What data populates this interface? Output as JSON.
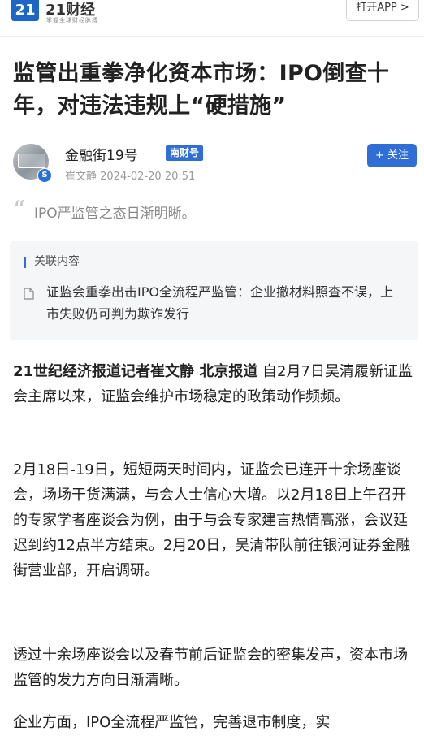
{
  "header": {
    "logo_number": "21",
    "logo_name": "21财经",
    "logo_slogan": "掌握全球财经脉搏",
    "open_app_label": "打开APP >"
  },
  "article": {
    "title": "监管出重拳净化资本市场：IPO倒查十年，对违法违规上“硬措施”",
    "author": {
      "name": "金融街19号",
      "tag": "南财号",
      "meta": "崔文静 2024-02-20 20:51",
      "badge": "S"
    },
    "follow_label": "+ 关注",
    "summary": "IPO严监管之态日渐明晰。",
    "related": {
      "heading": "关联内容",
      "link": "证监会重拳出击IPO全流程严监管：企业撤材料照查不误，上市失败仍可判为欺诈发行"
    },
    "paragraphs": {
      "p1_bold": "21世纪经济报道记者崔文静 北京报道",
      "p1_rest": " 自2月7日吴清履新证监会主席以来，证监会维护市场稳定的政策动作频频。",
      "p2": "2月18日-19日，短短两天时间内，证监会已连开十余场座谈会，场场干货满满，与会人士信心大增。以2月18日上午召开的专家学者座谈会为例，由于与会专家建言热情高涨，会议延迟到约12点半方结束。2月20日，吴清带队前往银河证券金融街营业部，开启调研。",
      "p3": "透过十余场座谈会以及春节前后证监会的密集发声，资本市场监管的发力方向日渐清晰。",
      "p4": "企业方面，IPO全流程严监管，完善退市制度，实"
    }
  }
}
